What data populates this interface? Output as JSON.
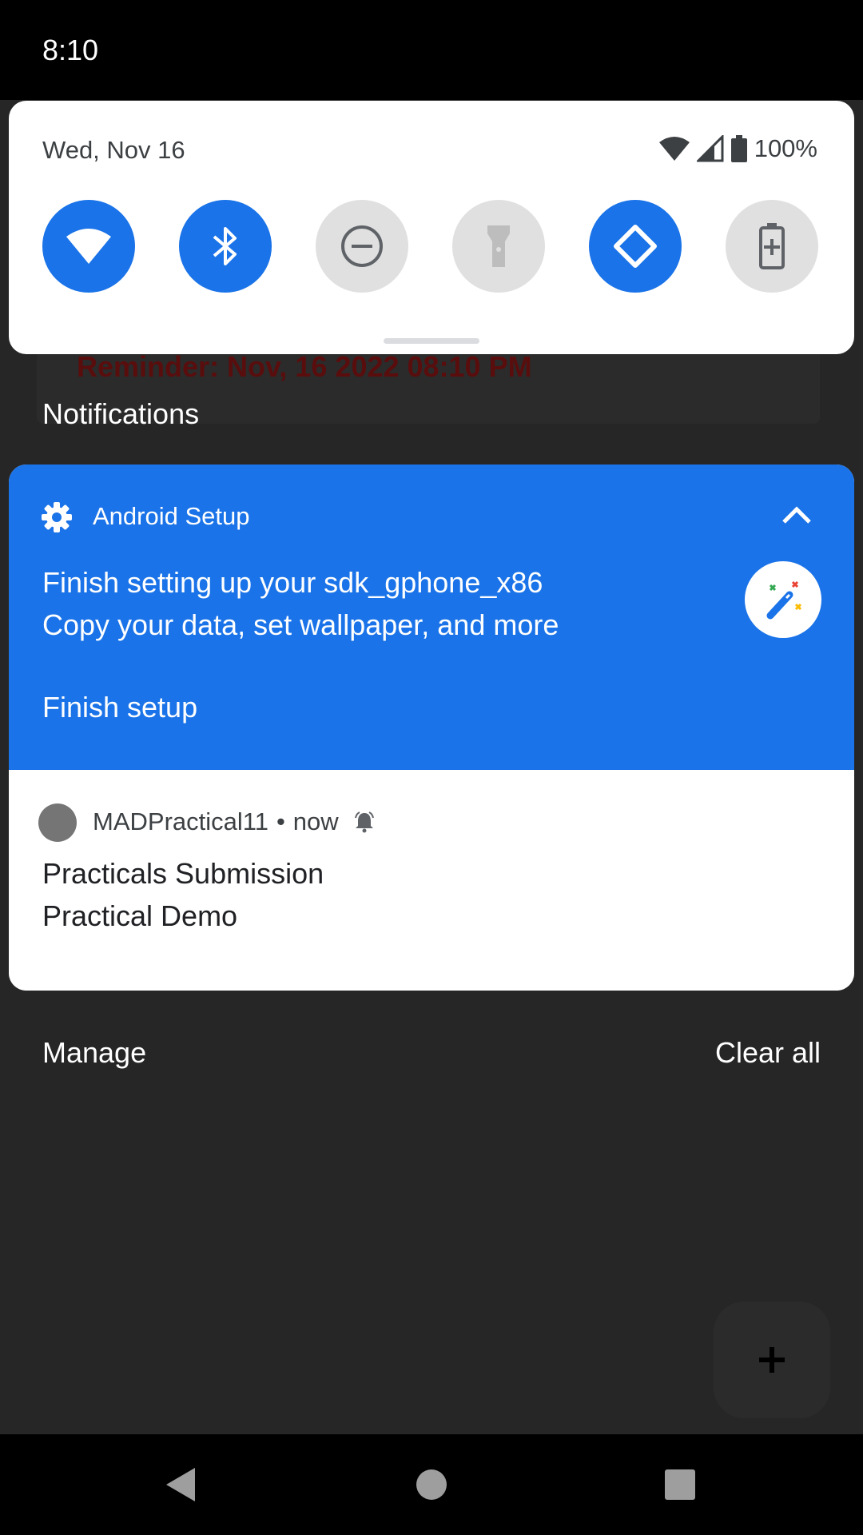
{
  "status_bar": {
    "time": "8:10"
  },
  "app_background": {
    "reminder_text": "Reminder: Nov, 16 2022 08:10 PM"
  },
  "quick_settings": {
    "date": "Wed, Nov 16",
    "battery_percent": "100%",
    "tiles": [
      {
        "icon": "wifi-icon",
        "state": "on"
      },
      {
        "icon": "bluetooth-icon",
        "state": "on"
      },
      {
        "icon": "do-not-disturb-icon",
        "state": "off"
      },
      {
        "icon": "flashlight-icon",
        "state": "off"
      },
      {
        "icon": "auto-rotate-icon",
        "state": "on"
      },
      {
        "icon": "battery-saver-icon",
        "state": "off"
      }
    ]
  },
  "notifications_header": "Notifications",
  "notifications": [
    {
      "app": "Android Setup",
      "title": "Finish setting up your sdk_gphone_x86",
      "text": "Copy your data, set wallpaper, and more",
      "action": "Finish setup",
      "color": "#1a73e8"
    },
    {
      "app": "MADPractical11",
      "time": "now",
      "title": "Practicals Submission",
      "text": "Practical Demo"
    }
  ],
  "footer": {
    "manage": "Manage",
    "clear_all": "Clear all"
  },
  "colors": {
    "accent": "#1a73e8",
    "shade_bg": "#262626",
    "tile_off": "#e0e0e0"
  }
}
